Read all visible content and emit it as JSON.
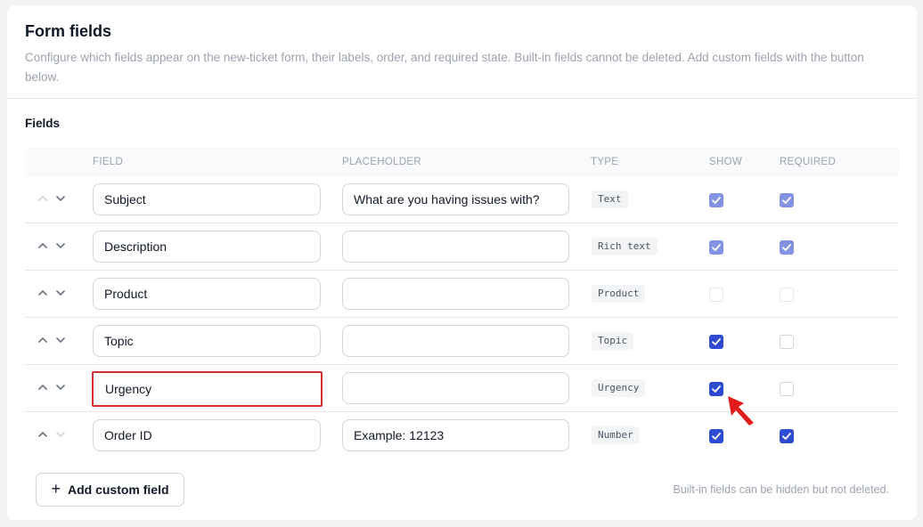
{
  "header": {
    "title": "Form fields",
    "description": "Configure which fields appear on the new-ticket form, their labels, order, and required state. Built-in fields cannot be deleted. Add custom fields with the button below."
  },
  "section_title": "Fields",
  "columns": {
    "field": "FIELD",
    "placeholder": "PLACEHOLDER",
    "type": "TYPE",
    "show": "SHOW",
    "required": "REQUIRED"
  },
  "rows": [
    {
      "label": "Subject",
      "placeholder": "What are you having issues with?",
      "type": "Text",
      "show": true,
      "required": true,
      "locked": true
    },
    {
      "label": "Description",
      "placeholder": "",
      "type": "Rich text",
      "show": true,
      "required": true,
      "locked": true
    },
    {
      "label": "Product",
      "placeholder": "",
      "type": "Product",
      "show": false,
      "required": false,
      "locked": true
    },
    {
      "label": "Topic",
      "placeholder": "",
      "type": "Topic",
      "show": true,
      "required": false,
      "locked": false
    },
    {
      "label": "Urgency",
      "placeholder": "",
      "type": "Urgency",
      "show": true,
      "required": false,
      "locked": false
    },
    {
      "label": "Order ID",
      "placeholder": "Example: 12123",
      "type": "Number",
      "show": true,
      "required": true,
      "locked": false
    }
  ],
  "add_button_label": "Add custom field",
  "footnote": "Built-in fields can be hidden but not deleted.",
  "colors": {
    "accent": "#2f4bd1",
    "accent_disabled": "#8393e4",
    "highlight_box": "#d32f2f",
    "pointer": "#e31b1b"
  },
  "icons": {
    "move_up": "chevron-up-icon",
    "move_down": "chevron-down-icon",
    "add": "plus-icon",
    "check": "check-icon",
    "pointer": "arrow-pointer-icon"
  }
}
